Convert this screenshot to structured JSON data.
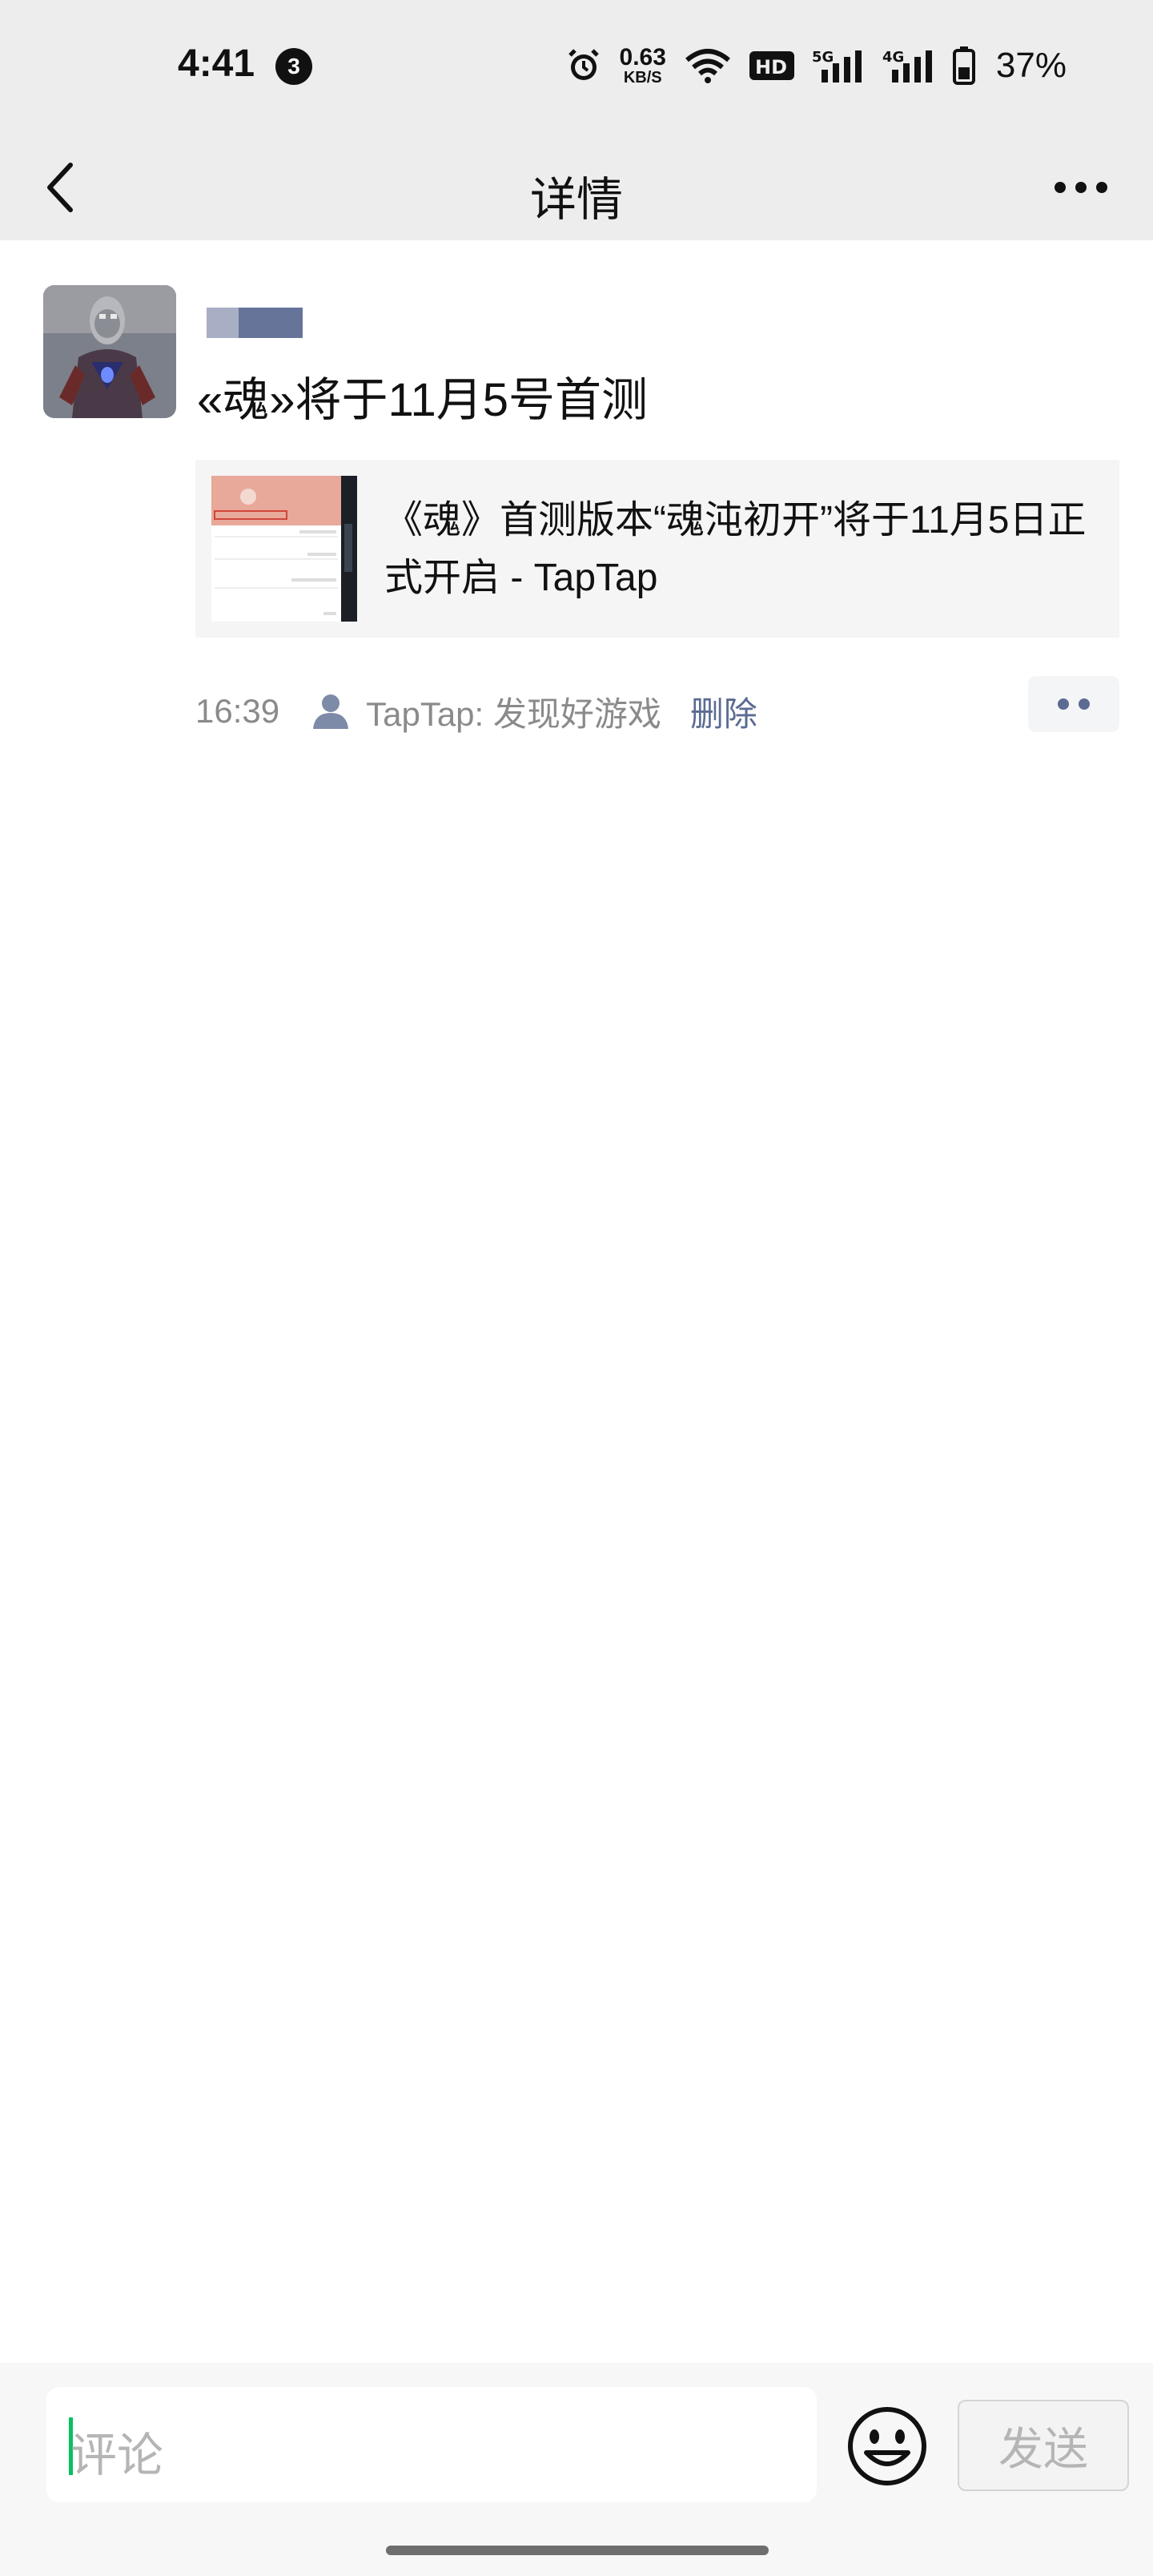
{
  "status_bar": {
    "time": "4:41",
    "notification_count": "3",
    "net_speed_value": "0.63",
    "net_speed_unit": "KB/S",
    "hd_label": "HD",
    "signal_1_label": "5G",
    "signal_2_label": "4G",
    "battery_percent": "37%",
    "icons": [
      "alarm-icon",
      "wifi-icon",
      "hd-icon",
      "signal-5g-icon",
      "signal-4g-icon",
      "battery-icon"
    ]
  },
  "nav": {
    "title": "详情",
    "back_icon": "chevron-left-icon",
    "more_icon": "more-dots-icon"
  },
  "post": {
    "text": "«魂»将于11月5号首测",
    "link": {
      "title": "《魂》首测版本“魂沌初开”将于11月5日正式开启 - TapTap"
    },
    "time": "16:39",
    "source": "TapTap: 发现好游戏",
    "delete_label": "删除"
  },
  "comment_bar": {
    "placeholder": "评论",
    "send_label": "发送",
    "emoji_icon": "smiley-icon"
  },
  "colors": {
    "header_bg": "#ededed",
    "link_blue": "#5b6b92",
    "accent_green": "#07c160",
    "card_bg": "#f5f5f5"
  }
}
